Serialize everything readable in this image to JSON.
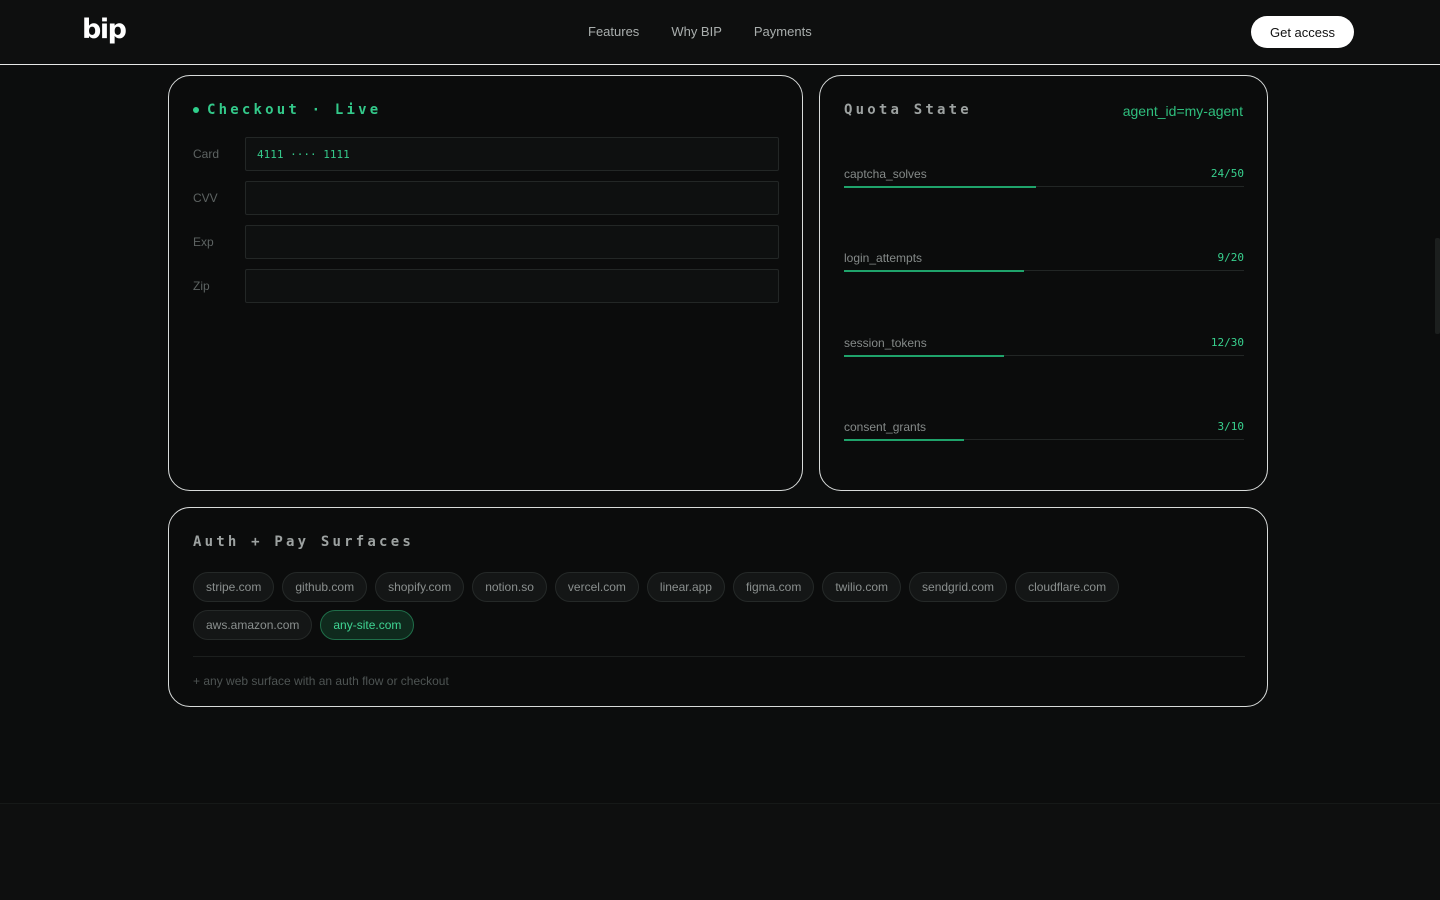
{
  "header": {
    "logo": "bip",
    "nav": [
      "Features",
      "Why BIP",
      "Payments"
    ],
    "cta": "Get access"
  },
  "checkout": {
    "title": "Checkout · Live",
    "fields": [
      {
        "label": "Card",
        "value": "4111 ···· 1111"
      },
      {
        "label": "CVV",
        "value": ""
      },
      {
        "label": "Exp",
        "value": ""
      },
      {
        "label": "Zip",
        "value": ""
      }
    ]
  },
  "quota": {
    "title": "Quota State",
    "agent_id": "agent_id=my-agent",
    "rows": [
      {
        "name": "captcha_solves",
        "value": "24/50",
        "fraction": 0.48
      },
      {
        "name": "login_attempts",
        "value": "9/20",
        "fraction": 0.45
      },
      {
        "name": "session_tokens",
        "value": "12/30",
        "fraction": 0.4
      },
      {
        "name": "consent_grants",
        "value": "3/10",
        "fraction": 0.3
      }
    ]
  },
  "surfaces": {
    "title": "Auth + Pay Surfaces",
    "chips": [
      "stripe.com",
      "github.com",
      "shopify.com",
      "notion.so",
      "vercel.com",
      "linear.app",
      "figma.com",
      "twilio.com",
      "sendgrid.com",
      "cloudflare.com",
      "aws.amazon.com",
      "any-site.com"
    ],
    "active_chip": "any-site.com",
    "footnote": "+ any web surface with an auth flow or checkout"
  },
  "colors": {
    "accent": "#2fd08c",
    "background": "#0c0d0d",
    "border": "#d8dbda"
  }
}
